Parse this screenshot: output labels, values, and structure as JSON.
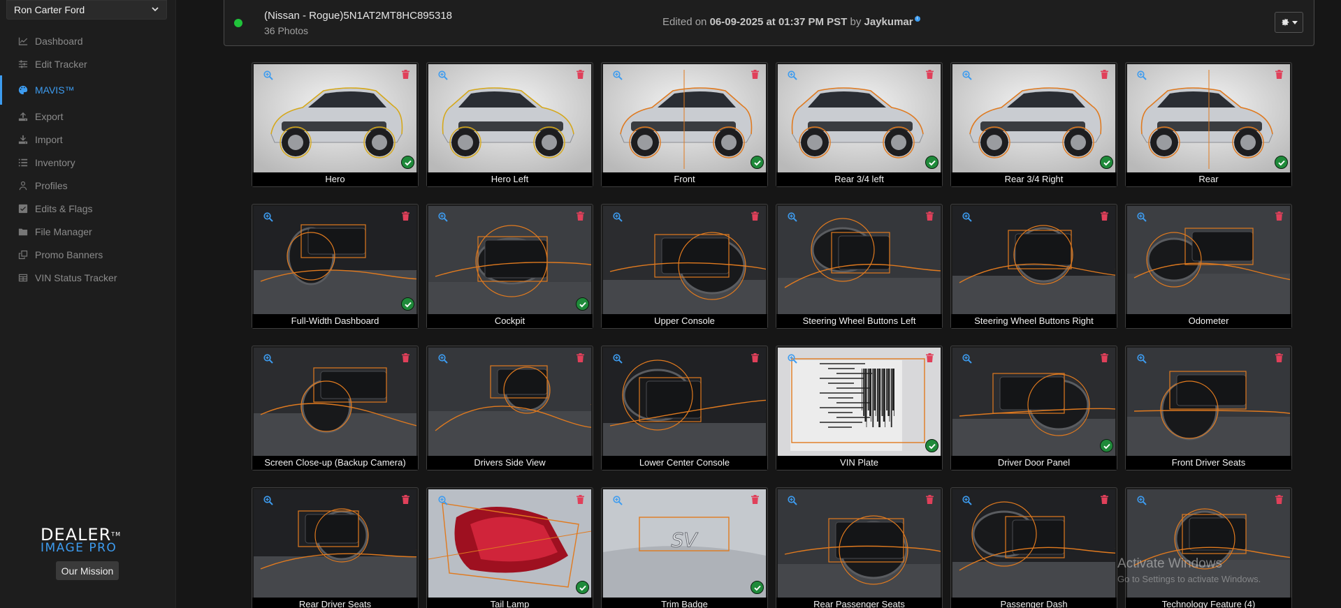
{
  "sidebar": {
    "dealer": "Ron Carter Ford",
    "items": [
      {
        "label": "Dashboard",
        "icon": "chart-line-icon",
        "active": false
      },
      {
        "label": "Edit Tracker",
        "icon": "sliders-icon",
        "active": false
      },
      {
        "label": "MAVIS™",
        "icon": "palette-icon",
        "active": true
      },
      {
        "label": "Export",
        "icon": "upload-icon",
        "active": false
      },
      {
        "label": "Import",
        "icon": "download-icon",
        "active": false
      },
      {
        "label": "Inventory",
        "icon": "list-icon",
        "active": false
      },
      {
        "label": "Profiles",
        "icon": "user-icon",
        "active": false
      },
      {
        "label": "Edits & Flags",
        "icon": "check-square-icon",
        "active": false
      },
      {
        "label": "File Manager",
        "icon": "folder-icon",
        "active": false
      },
      {
        "label": "Promo Banners",
        "icon": "clone-icon",
        "active": false
      },
      {
        "label": "VIN Status Tracker",
        "icon": "table-icon",
        "active": false
      }
    ],
    "brand_top": "DEALER",
    "brand_bottom": "IMAGE PRO",
    "mission_label": "Our Mission"
  },
  "header": {
    "title": "(Nissan - Rogue)5N1AT2MT8HC895318",
    "photo_count": "36 Photos",
    "edited_prefix": "Edited on ",
    "edited_date": "06-09-2025 at 01:37 PM PST",
    "edited_by": " by ",
    "editor": "Jaykumar",
    "status_color": "#20c33a"
  },
  "photos": [
    {
      "label": "Hero",
      "checked": true,
      "scene": "exterior"
    },
    {
      "label": "Hero Left",
      "checked": false,
      "scene": "exterior"
    },
    {
      "label": "Front",
      "checked": true,
      "scene": "exterior"
    },
    {
      "label": "Rear 3/4 left",
      "checked": true,
      "scene": "exterior"
    },
    {
      "label": "Rear 3/4 Right",
      "checked": true,
      "scene": "exterior"
    },
    {
      "label": "Rear",
      "checked": true,
      "scene": "exterior"
    },
    {
      "label": "Full-Width Dashboard",
      "checked": true,
      "scene": "interior"
    },
    {
      "label": "Cockpit",
      "checked": true,
      "scene": "interior"
    },
    {
      "label": "Upper Console",
      "checked": false,
      "scene": "interior"
    },
    {
      "label": "Steering Wheel Buttons Left",
      "checked": false,
      "scene": "interior"
    },
    {
      "label": "Steering Wheel Buttons Right",
      "checked": false,
      "scene": "interior"
    },
    {
      "label": "Odometer",
      "checked": false,
      "scene": "interior"
    },
    {
      "label": "Screen Close-up (Backup Camera)",
      "checked": false,
      "scene": "interior"
    },
    {
      "label": "Drivers Side View",
      "checked": false,
      "scene": "interior"
    },
    {
      "label": "Lower Center Console",
      "checked": false,
      "scene": "interior"
    },
    {
      "label": "VIN Plate",
      "checked": true,
      "scene": "plate"
    },
    {
      "label": "Driver Door Panel",
      "checked": true,
      "scene": "interior"
    },
    {
      "label": "Front Driver Seats",
      "checked": false,
      "scene": "interior"
    },
    {
      "label": "Rear Driver Seats",
      "checked": false,
      "scene": "interior"
    },
    {
      "label": "Tail Lamp",
      "checked": true,
      "scene": "taillamp"
    },
    {
      "label": "Trim Badge",
      "checked": true,
      "scene": "badge"
    },
    {
      "label": "Rear Passenger Seats",
      "checked": false,
      "scene": "interior"
    },
    {
      "label": "Passenger Dash",
      "checked": false,
      "scene": "interior"
    },
    {
      "label": "Technology Feature (4)",
      "checked": false,
      "scene": "interior"
    }
  ],
  "watermark": {
    "title": "Activate Windows",
    "subtitle": "Go to Settings to activate Windows."
  },
  "colors": {
    "accent": "#3d9cf0",
    "outline": "#e07a1f",
    "delete": "#e0405a",
    "check": "#1f8a3a"
  }
}
